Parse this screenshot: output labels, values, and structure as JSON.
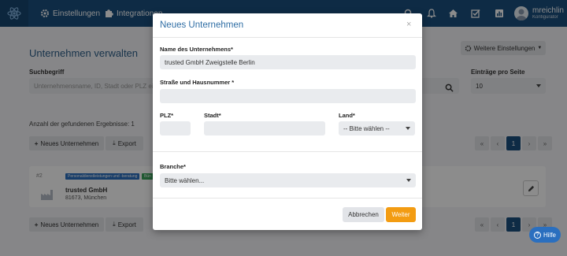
{
  "nav": {
    "settings_label": "Einstellungen",
    "integrations_label": "Integrationen",
    "user_name": "mreichlin",
    "user_role": "Konfigurator"
  },
  "page": {
    "title": "Unternehmen verwalten",
    "more_settings_label": "Weitere Einstellungen",
    "search_label": "Suchbegriff",
    "search_placeholder": "Unternehmensname, ID, Stadt oder PLZ eingeben",
    "perpage_label": "Einträge pro Seite",
    "perpage_value": "10",
    "results_count": "Anzahl der gefundenen Ergebnisse: 1",
    "new_company_label": "Neues Unternehmen",
    "export_label": "Export",
    "pager": {
      "first": "«",
      "prev": "‹",
      "current": "1",
      "next": "›",
      "last": "»"
    },
    "card": {
      "number": "#2",
      "tag1": "Personaldienstleistungen und -beratung",
      "tag2": "Bün",
      "name": "trusted GmbH",
      "location": "81673, München"
    },
    "help_label": "Hilfe"
  },
  "modal": {
    "title": "Neues Unternehmen",
    "close_symbol": "×",
    "name_label": "Name des Unternehmens*",
    "name_value": "trusted GmbH Zweigstelle Berlin",
    "street_label": "Straße und Hausnummer *",
    "street_value": "",
    "plz_label": "PLZ*",
    "plz_value": "",
    "city_label": "Stadt*",
    "city_value": "",
    "country_label": "Land*",
    "country_value": "-- Bitte wählen --",
    "branch_label": "Branche*",
    "branch_value": "Bitte wählen...",
    "cancel_label": "Abbrechen",
    "next_label": "Weiter"
  },
  "colors": {
    "navbar": "#1a4f7f",
    "accent": "#2e6da4",
    "primary_button": "#f39c12",
    "help_button": "#2a6fbf"
  },
  "icons": [
    "logo-icon",
    "gear-icon",
    "puzzle-icon",
    "search-icon",
    "bell-icon",
    "home-icon",
    "tasks-icon",
    "chart-icon",
    "factory-icon",
    "pencil-icon",
    "plus-icon",
    "download-icon",
    "question-icon"
  ]
}
